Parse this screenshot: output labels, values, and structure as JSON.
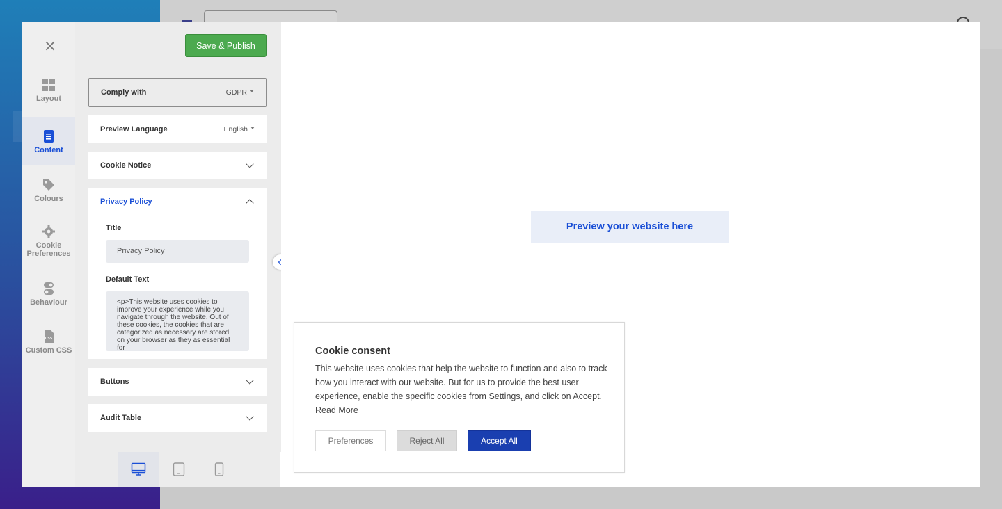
{
  "toolbar": {
    "close_label": "×",
    "save_label": "Save & Publish"
  },
  "rail": {
    "items": [
      {
        "label": "Layout",
        "icon": "grid-icon",
        "active": false
      },
      {
        "label": "Content",
        "icon": "document-icon",
        "active": true
      },
      {
        "label": "Colours",
        "icon": "tag-icon",
        "active": false
      },
      {
        "label": "Cookie Preferences",
        "icon": "gear-icon",
        "active": false
      },
      {
        "label": "Behaviour",
        "icon": "toggle-icon",
        "active": false
      },
      {
        "label": "Custom CSS",
        "icon": "css-file-icon",
        "active": false
      }
    ]
  },
  "settings": {
    "comply": {
      "label": "Comply with",
      "value": "GDPR"
    },
    "language": {
      "label": "Preview Language",
      "value": "English"
    },
    "cookie_notice": {
      "label": "Cookie Notice"
    },
    "privacy_policy": {
      "label": "Privacy Policy",
      "title_label": "Title",
      "title_value": "Privacy Policy",
      "text_label": "Default Text",
      "text_value": "<p>This website uses cookies to improve your experience while you navigate through the website. Out of these cookies, the cookies that are categorized as necessary are stored on your browser as they as essential for"
    },
    "buttons": {
      "label": "Buttons"
    },
    "audit_table": {
      "label": "Audit Table"
    }
  },
  "devices": [
    {
      "name": "desktop",
      "active": true
    },
    {
      "name": "tablet",
      "active": false
    },
    {
      "name": "mobile",
      "active": false
    }
  ],
  "preview": {
    "placeholder": "Preview your website here"
  },
  "cookie_banner": {
    "title": "Cookie consent",
    "body": "This website uses cookies that help the website to function and also to track how you interact with our website. But for us to provide the best user experience, enable the specific cookies from Settings, and click on Accept.",
    "read_more": "Read More",
    "preferences_label": "Preferences",
    "reject_label": "Reject All",
    "accept_label": "Accept All"
  },
  "colors": {
    "accent": "#1a4fd6",
    "save_green": "#4caa4f",
    "accept_blue": "#1a3fb0"
  }
}
